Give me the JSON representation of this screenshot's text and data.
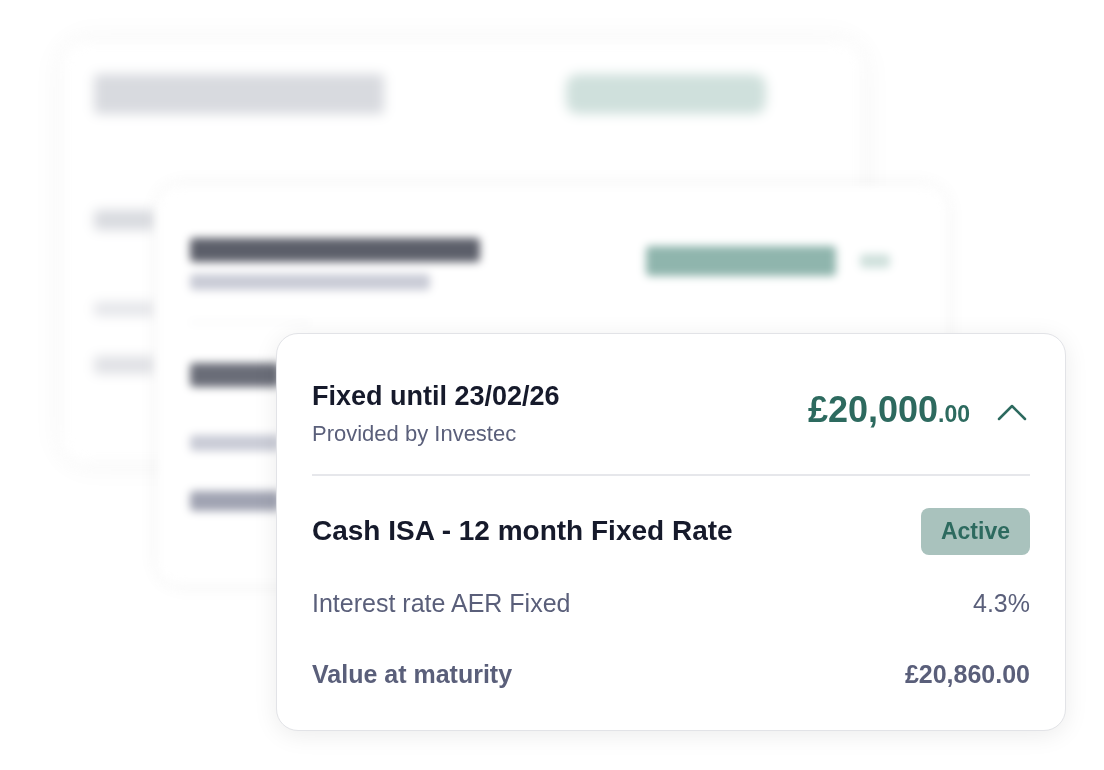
{
  "front_card": {
    "title": "Fixed until 23/02/26",
    "provider": "Provided by Investec",
    "amount": "£20,000",
    "amount_minor": ".00",
    "expanded": true,
    "product": "Cash ISA - 12 month Fixed Rate",
    "status": "Active",
    "rows": [
      {
        "kind": "plain",
        "label": "Interest rate AER Fixed",
        "value": "4.3%"
      },
      {
        "kind": "total",
        "label": "Value at maturity",
        "value": "£20,860.00"
      }
    ]
  }
}
